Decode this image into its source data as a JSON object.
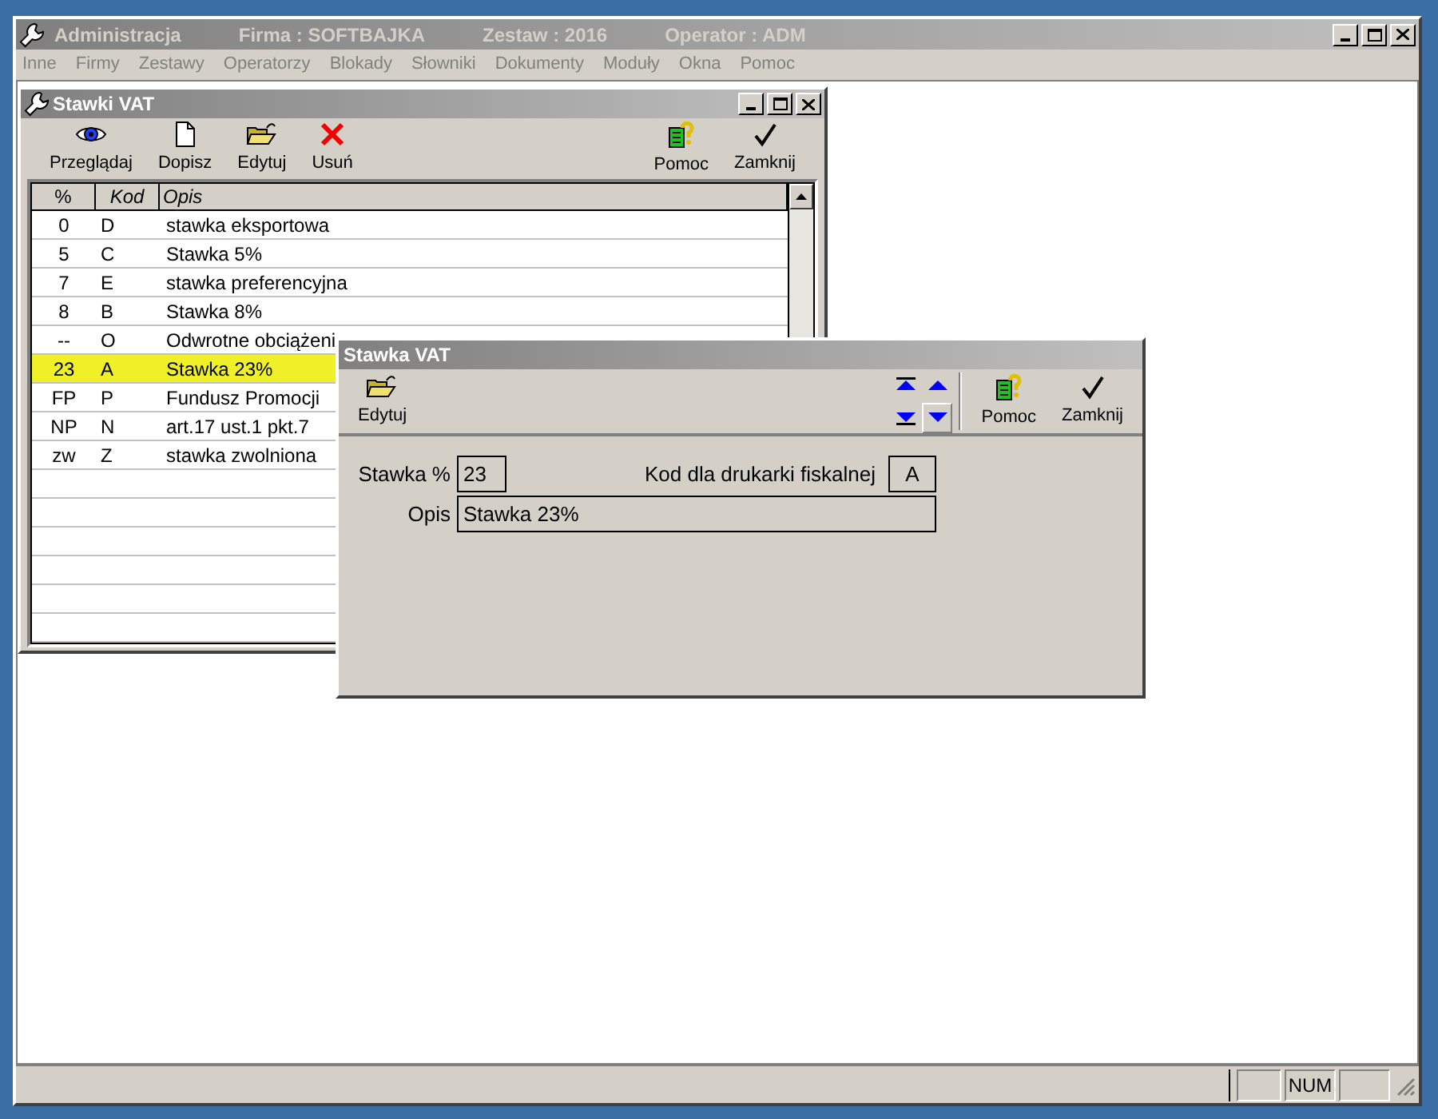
{
  "app_window": {
    "title": "Administracja",
    "firma": "Firma : SOFTBAJKA",
    "zestaw": "Zestaw : 2016",
    "operator": "Operator : ADM"
  },
  "menu": [
    "Inne",
    "Firmy",
    "Zestawy",
    "Operatorzy",
    "Blokady",
    "Słowniki",
    "Dokumenty",
    "Moduły",
    "Okna",
    "Pomoc"
  ],
  "list_window": {
    "title": "Stawki VAT",
    "toolbar_left": [
      "Przeglądaj",
      "Dopisz",
      "Edytuj",
      "Usuń"
    ],
    "toolbar_right": [
      "Pomoc",
      "Zamknij"
    ],
    "columns": [
      "%",
      "Kod",
      "Opis"
    ],
    "rows": [
      {
        "cells": [
          "0",
          "D",
          "stawka eksportowa"
        ],
        "selected": false
      },
      {
        "cells": [
          "5",
          "C",
          "Stawka 5%"
        ],
        "selected": false
      },
      {
        "cells": [
          "7",
          "E",
          "stawka preferencyjna"
        ],
        "selected": false
      },
      {
        "cells": [
          "8",
          "B",
          "Stawka 8%"
        ],
        "selected": false
      },
      {
        "cells": [
          "--",
          "O",
          "Odwrotne obciążeni"
        ],
        "selected": false
      },
      {
        "cells": [
          "23",
          "A",
          "Stawka 23%"
        ],
        "selected": true
      },
      {
        "cells": [
          "FP",
          "P",
          "Fundusz Promocji"
        ],
        "selected": false
      },
      {
        "cells": [
          "NP",
          "N",
          "art.17 ust.1 pkt.7"
        ],
        "selected": false
      },
      {
        "cells": [
          "zw",
          "Z",
          "stawka zwolniona"
        ],
        "selected": false
      }
    ]
  },
  "dialog": {
    "title": "Stawka VAT",
    "toolbar_left": [
      "Edytuj"
    ],
    "toolbar_right": [
      "Pomoc",
      "Zamknij"
    ],
    "fields": [
      {
        "label": "Stawka %",
        "value": "23"
      },
      {
        "label": "Kod dla drukarki fiskalnej",
        "value": "A"
      },
      {
        "label": "Opis",
        "value": "Stawka 23%"
      }
    ]
  },
  "status_bar": {
    "num": "NUM"
  }
}
